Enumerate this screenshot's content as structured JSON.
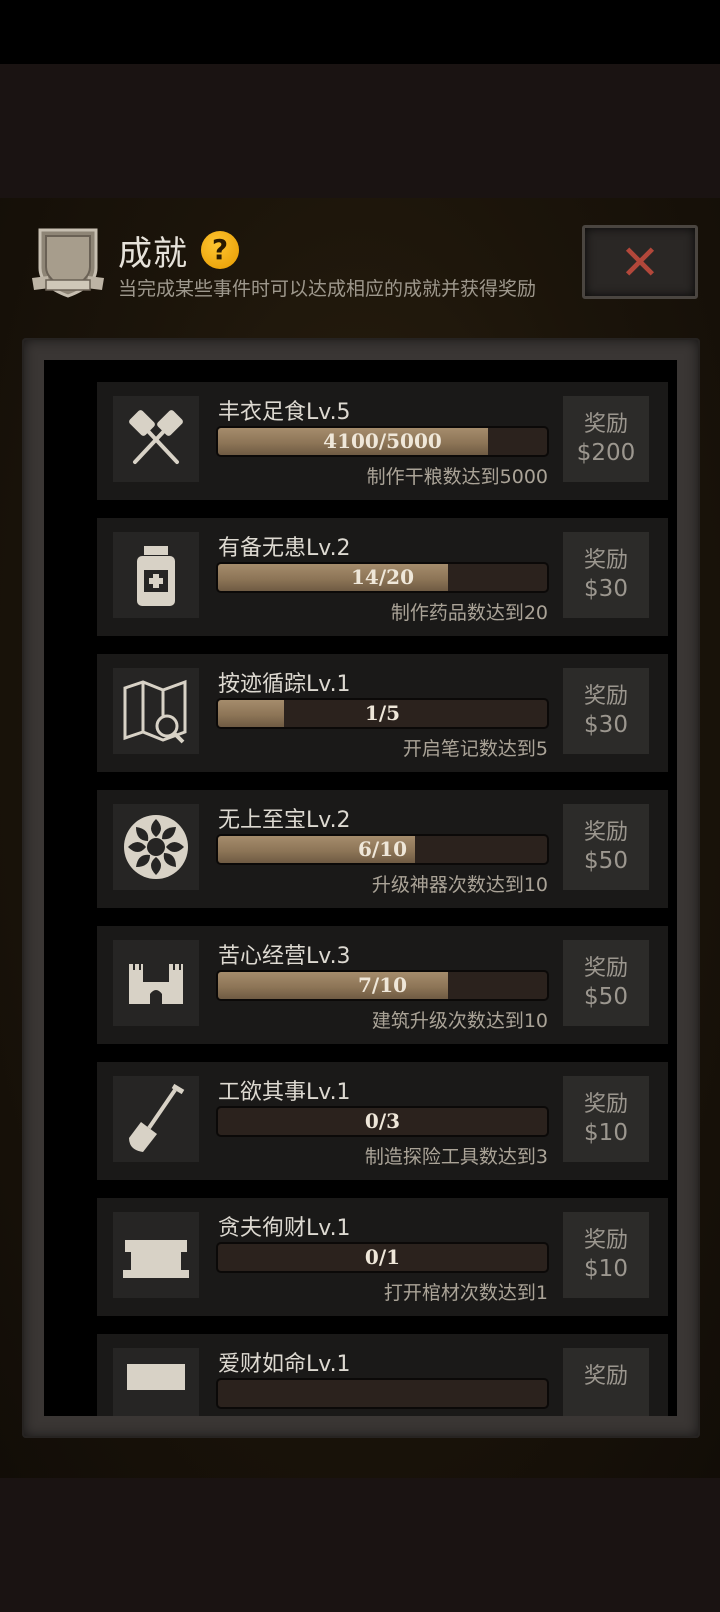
{
  "header": {
    "title": "成就",
    "help": "?",
    "subtitle": "当完成某些事件时可以达成相应的成就并获得奖励",
    "close": "✕"
  },
  "achievements": [
    {
      "name": "丰衣足食Lv.5",
      "progress": "4100/5000",
      "ratio": 0.82,
      "desc": "制作干粮数达到5000",
      "reward_label": "奖励",
      "reward": "$200",
      "icon": "crossed-utensils-icon"
    },
    {
      "name": "有备无患Lv.2",
      "progress": "14/20",
      "ratio": 0.7,
      "desc": "制作药品数达到20",
      "reward_label": "奖励",
      "reward": "$30",
      "icon": "medicine-bottle-icon"
    },
    {
      "name": "按迹循踪Lv.1",
      "progress": "1/5",
      "ratio": 0.2,
      "desc": "开启笔记数达到5",
      "reward_label": "奖励",
      "reward": "$30",
      "icon": "map-search-icon"
    },
    {
      "name": "无上至宝Lv.2",
      "progress": "6/10",
      "ratio": 0.6,
      "desc": "升级神器次数达到10",
      "reward_label": "奖励",
      "reward": "$50",
      "icon": "ornament-icon"
    },
    {
      "name": "苦心经营Lv.3",
      "progress": "7/10",
      "ratio": 0.7,
      "desc": "建筑升级次数达到10",
      "reward_label": "奖励",
      "reward": "$50",
      "icon": "castle-icon"
    },
    {
      "name": "工欲其事Lv.1",
      "progress": "0/3",
      "ratio": 0,
      "desc": "制造探险工具数达到3",
      "reward_label": "奖励",
      "reward": "$10",
      "icon": "shovel-icon"
    },
    {
      "name": "贪夫徇财Lv.1",
      "progress": "0/1",
      "ratio": 0,
      "desc": "打开棺材次数达到1",
      "reward_label": "奖励",
      "reward": "$10",
      "icon": "coffin-icon"
    },
    {
      "name": "爱财如命Lv.1",
      "progress": "",
      "ratio": 0,
      "desc": "",
      "reward_label": "奖励",
      "reward": "",
      "icon": "money-icon"
    }
  ],
  "colors": {
    "accent": "#b2473a",
    "bar_fill": "#8d7557",
    "help": "#f5b21a"
  }
}
